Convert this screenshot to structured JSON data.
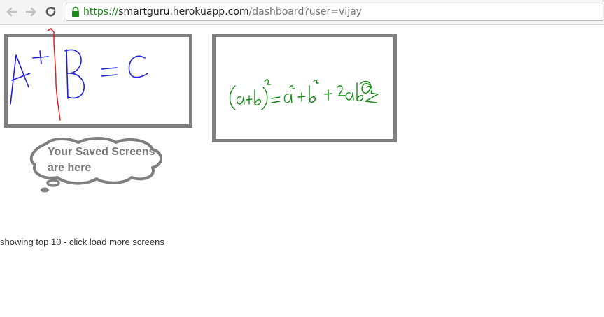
{
  "browser": {
    "url_scheme": "https://",
    "url_host": "smartguru.herokuapp.com",
    "url_path": "/dashboard?user=vijay"
  },
  "tooltip": {
    "text": "Your Saved Screens are here"
  },
  "footer": {
    "note": "showing top 10 - click load more screens"
  },
  "colors": {
    "screen_border": "#7f7f7f",
    "ink_blue": "#1f1fe0",
    "ink_green": "#138a13",
    "ink_red": "#e02020",
    "tooltip_text": "#7a7a7a"
  }
}
